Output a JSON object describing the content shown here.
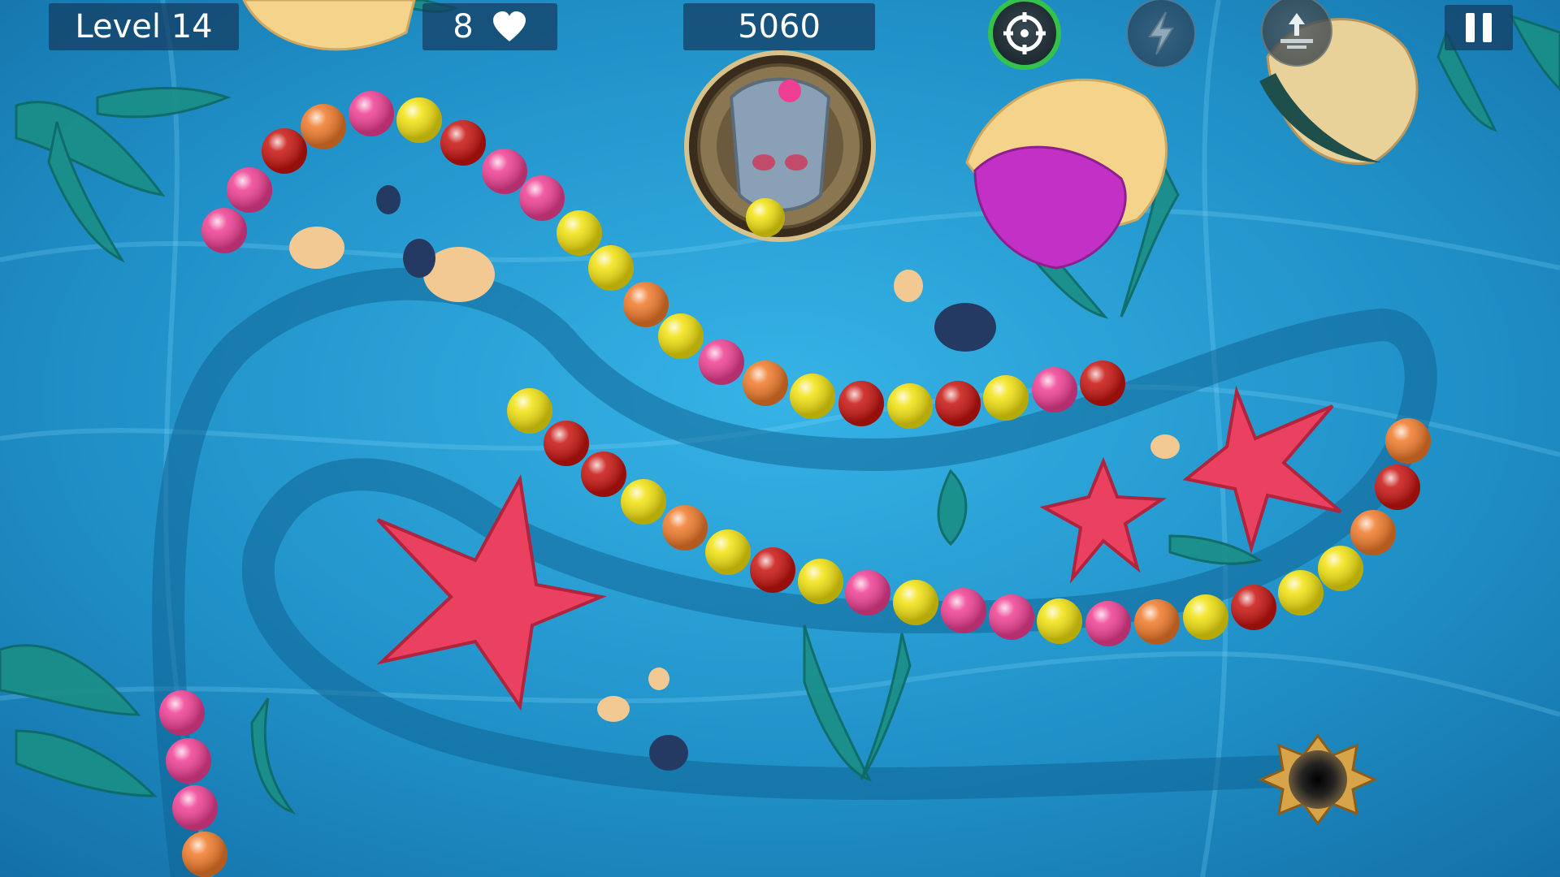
{
  "hud": {
    "level_label": "Level 14",
    "lives": "8",
    "score": "5060"
  },
  "icons": {
    "lives": "heart-icon",
    "target": "crosshair-icon",
    "bolt": "lightning-bolt-icon",
    "reverse": "reverse-arrow-icon",
    "pause": "pause-icon",
    "shooter": "frog-idol-shooter",
    "hole": "skull-hole"
  },
  "shooter": {
    "loaded_ball": "yellow",
    "next_ball": "pink"
  },
  "colors": {
    "red": "#c8140f",
    "orange": "#f07a2a",
    "pink": "#ef3f93",
    "yellow": "#f2e20f",
    "water": "#1f8ec4",
    "hud_panel": "#143c5f"
  },
  "chains": [
    {
      "name": "upper-chain",
      "balls": [
        "pink",
        "pink",
        "red",
        "orange",
        "pink",
        "yellow",
        "red",
        "pink",
        "pink",
        "yellow",
        "yellow",
        "orange",
        "yellow",
        "pink",
        "orange",
        "yellow",
        "red",
        "yellow",
        "red",
        "yellow",
        "pink",
        "red"
      ]
    },
    {
      "name": "middle-chain",
      "balls": [
        "yellow",
        "red",
        "red",
        "yellow",
        "orange",
        "yellow",
        "red",
        "yellow",
        "pink",
        "yellow",
        "pink",
        "pink",
        "yellow",
        "pink",
        "orange",
        "yellow",
        "red",
        "yellow",
        "yellow",
        "orange",
        "red",
        "orange"
      ]
    },
    {
      "name": "lower-left-chain",
      "balls": [
        "pink",
        "pink",
        "pink",
        "orange"
      ]
    }
  ]
}
